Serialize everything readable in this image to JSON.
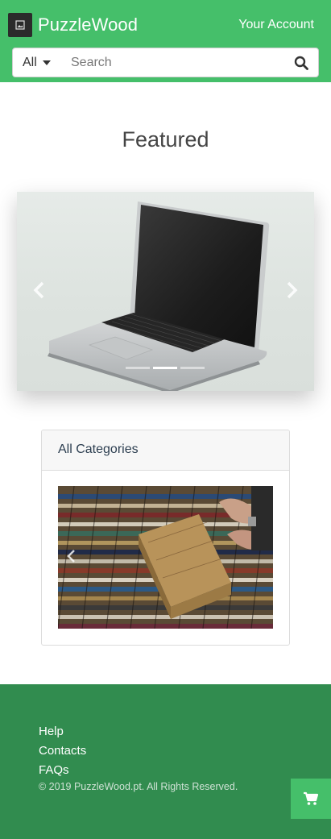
{
  "header": {
    "brand": "PuzzleWood",
    "account_label": "Your Account",
    "logo_icon": "image-icon",
    "bg_color": "#45bf6a"
  },
  "search": {
    "category_selected": "All",
    "placeholder": "Search",
    "button_icon": "search-icon"
  },
  "featured": {
    "title": "Featured",
    "slides_count_visible": 3,
    "active_slide": 2
  },
  "categories_card": {
    "title": "All Categories"
  },
  "footer": {
    "links": [
      "Help",
      "Contacts",
      "FAQs"
    ],
    "copyright": "© 2019 PuzzleWood.pt. All Rights Reserved.",
    "bg_color": "#318c4f"
  },
  "cart": {
    "icon": "cart-icon"
  }
}
